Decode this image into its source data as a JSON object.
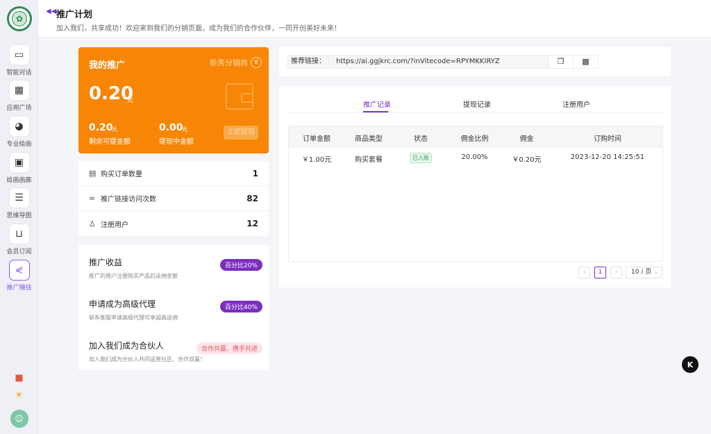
{
  "rail": {
    "items": [
      {
        "label": "智能对话",
        "icon": "chat-icon"
      },
      {
        "label": "应用广场",
        "icon": "grid-icon"
      },
      {
        "label": "专业绘画",
        "icon": "palette-icon"
      },
      {
        "label": "绘画画廊",
        "icon": "gallery-icon"
      },
      {
        "label": "思维导图",
        "icon": "mindmap-icon"
      },
      {
        "label": "会员订阅",
        "icon": "cart-icon"
      },
      {
        "label": "推广赚钱",
        "icon": "share-icon"
      }
    ]
  },
  "header": {
    "title": "推广计划",
    "subtitle": "加入我们，共享成功！欢迎来到我们的分销页面，成为我们的合作伙伴，一同开创美好未来！"
  },
  "promo": {
    "title": "我的推广",
    "badge": "新秀分销商",
    "amount": "0.20",
    "unit": "元",
    "withdrawable_value": "0.20",
    "withdrawable_unit": "元",
    "withdrawable_label": "剩余可提金额",
    "pending_value": "0.00",
    "pending_unit": "元",
    "pending_label": "提现中金额",
    "withdraw_button": "立即提现"
  },
  "stats": [
    {
      "label": "购买订单数量",
      "value": "1",
      "icon": "clipboard-icon"
    },
    {
      "label": "推广链接访问次数",
      "value": "82",
      "icon": "link-icon"
    },
    {
      "label": "注册用户",
      "value": "12",
      "icon": "user-icon"
    }
  ],
  "benefits": [
    {
      "title": "推广收益",
      "desc": "推广的用户注册购买产品后返佣金额",
      "tag": "百分比20%"
    },
    {
      "title": "申请成为高级代理",
      "desc": "联系客服申请高级代理可享超高返佣",
      "tag": "百分比40%"
    },
    {
      "title": "加入我们成为合伙人",
      "desc": "加入我们成为合伙人共同运营社区、合作双赢！",
      "tag": "合作共赢、携手共进"
    }
  ],
  "link": {
    "label": "推荐链接：",
    "url": "https://ai.ggjkrc.com/?inVitecode=RPYMKKIRYZ"
  },
  "tabs": [
    "推广记录",
    "提现记录",
    "注册用户"
  ],
  "table": {
    "headers": [
      "订单金额",
      "商品类型",
      "状态",
      "佣金比例",
      "佣金",
      "订购时间"
    ],
    "rows": [
      [
        "￥1.00元",
        "购买套餐",
        "已入账",
        "20.00%",
        "￥0.20元",
        "2023-12-20 14:25:51"
      ]
    ]
  },
  "pagination": {
    "current": "1",
    "page_size": "10 / 页"
  },
  "colors": {
    "accent": "#7b2fbf",
    "orange": "#f78506"
  }
}
